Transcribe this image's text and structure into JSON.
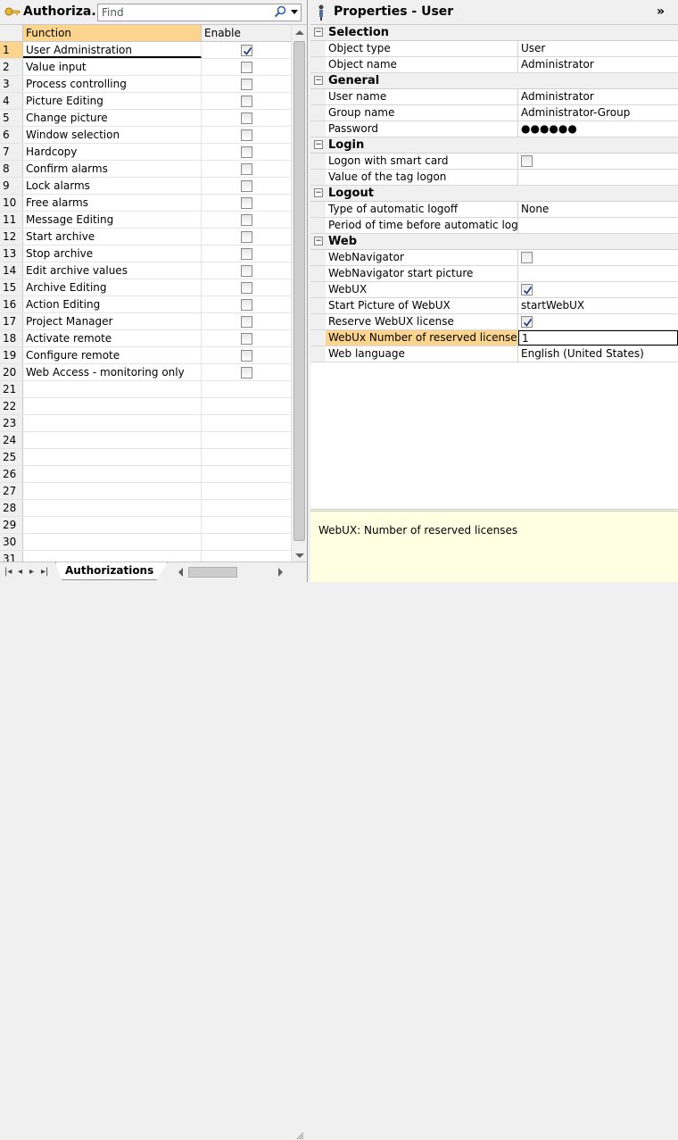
{
  "left": {
    "title": "Authoriza...",
    "search_placeholder": "Find",
    "columns": {
      "function": "Function",
      "enable": "Enable"
    },
    "rows": [
      {
        "n": "1",
        "name": "User Administration",
        "checked": true
      },
      {
        "n": "2",
        "name": "Value input",
        "checked": false
      },
      {
        "n": "3",
        "name": "Process controlling",
        "checked": false
      },
      {
        "n": "4",
        "name": "Picture Editing",
        "checked": false
      },
      {
        "n": "5",
        "name": "Change picture",
        "checked": false
      },
      {
        "n": "6",
        "name": "Window selection",
        "checked": false
      },
      {
        "n": "7",
        "name": "Hardcopy",
        "checked": false
      },
      {
        "n": "8",
        "name": "Confirm alarms",
        "checked": false
      },
      {
        "n": "9",
        "name": "Lock alarms",
        "checked": false
      },
      {
        "n": "10",
        "name": "Free alarms",
        "checked": false
      },
      {
        "n": "11",
        "name": "Message Editing",
        "checked": false
      },
      {
        "n": "12",
        "name": "Start archive",
        "checked": false
      },
      {
        "n": "13",
        "name": "Stop archive",
        "checked": false
      },
      {
        "n": "14",
        "name": "Edit archive values",
        "checked": false
      },
      {
        "n": "15",
        "name": "Archive Editing",
        "checked": false
      },
      {
        "n": "16",
        "name": "Action Editing",
        "checked": false
      },
      {
        "n": "17",
        "name": "Project Manager",
        "checked": false
      },
      {
        "n": "18",
        "name": "Activate remote",
        "checked": false
      },
      {
        "n": "19",
        "name": "Configure remote",
        "checked": false
      },
      {
        "n": "20",
        "name": "Web Access - monitoring only",
        "checked": false
      },
      {
        "n": "21",
        "name": "",
        "checked": null
      },
      {
        "n": "22",
        "name": "",
        "checked": null
      },
      {
        "n": "23",
        "name": "",
        "checked": null
      },
      {
        "n": "24",
        "name": "",
        "checked": null
      },
      {
        "n": "25",
        "name": "",
        "checked": null
      },
      {
        "n": "26",
        "name": "",
        "checked": null
      },
      {
        "n": "27",
        "name": "",
        "checked": null
      },
      {
        "n": "28",
        "name": "",
        "checked": null
      },
      {
        "n": "29",
        "name": "",
        "checked": null
      },
      {
        "n": "30",
        "name": "",
        "checked": null
      },
      {
        "n": "31",
        "name": "",
        "checked": null
      }
    ],
    "tab_label": "Authorizations"
  },
  "right": {
    "title": "Properties - User",
    "sections": [
      {
        "label": "Selection",
        "props": [
          {
            "key": "Object type",
            "value": "User"
          },
          {
            "key": "Object name",
            "value": "Administrator"
          }
        ]
      },
      {
        "label": "General",
        "props": [
          {
            "key": "User name",
            "value": "Administrator"
          },
          {
            "key": "Group name",
            "value": "Administrator-Group"
          },
          {
            "key": "Password",
            "value": "●●●●●●"
          }
        ]
      },
      {
        "label": "Login",
        "props": [
          {
            "key": "Logon with smart card",
            "checkbox": false
          },
          {
            "key": "Value of the tag logon",
            "value": ""
          }
        ]
      },
      {
        "label": "Logout",
        "props": [
          {
            "key": "Type of automatic logoff",
            "value": "None"
          },
          {
            "key": "Period of time before automatic logoff",
            "value": ""
          }
        ]
      },
      {
        "label": "Web",
        "props": [
          {
            "key": "WebNavigator",
            "checkbox": false
          },
          {
            "key": "WebNavigator start picture",
            "value": ""
          },
          {
            "key": "WebUX",
            "checkbox": true
          },
          {
            "key": "Start Picture of WebUX",
            "value": "startWebUX"
          },
          {
            "key": "Reserve WebUX license",
            "checkbox": true
          },
          {
            "key": "WebUx Number of reserved licenses",
            "value": "1",
            "highlight": true
          },
          {
            "key": "Web language",
            "value": "English (United States)"
          }
        ]
      }
    ],
    "description": "WebUX: Number of reserved licenses"
  },
  "icons": {
    "title_left": "key-icon",
    "search": "magnifier-icon",
    "title_right": "user-pin-icon",
    "collapse": "double-chevron-right-icon"
  },
  "colors": {
    "highlight": "#fbd48e",
    "description_bg": "#ffffe1"
  }
}
